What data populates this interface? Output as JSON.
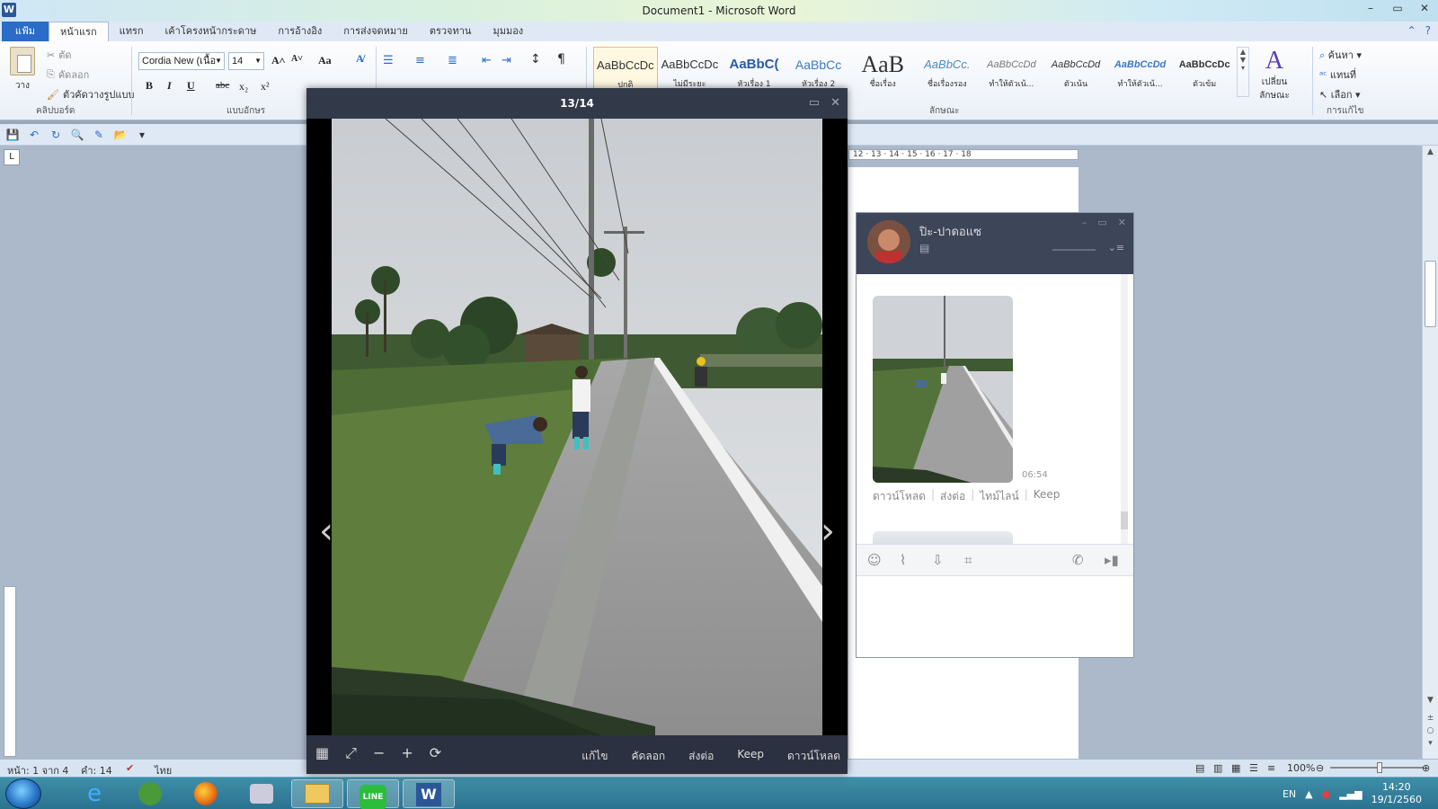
{
  "window": {
    "title": "Document1  -  Microsoft Word",
    "app_icon": "W",
    "controls": [
      "–",
      "▭",
      "✕"
    ]
  },
  "ribbon": {
    "tabs": [
      "แฟ้ม",
      "หน้าแรก",
      "แทรก",
      "เค้าโครงหน้ากระดาษ",
      "การอ้างอิง",
      "การส่งจดหมาย",
      "ตรวจทาน",
      "มุมมอง"
    ],
    "active_tab": "หน้าแรก",
    "clipboard": {
      "paste": "วาง",
      "cut": "ตัด",
      "copy": "คัดลอก",
      "format_painter": "ตัวคัดวางรูปแบบ",
      "label": "คลิปบอร์ด"
    },
    "font": {
      "name": "Cordia New (เนื้อ",
      "size": "14",
      "label": "แบบอักษร",
      "bold": "B",
      "italic": "I",
      "underline": "U",
      "strike": "abc",
      "subscript": "x₂",
      "superscript": "x²",
      "grow": "A˄",
      "shrink": "A˅",
      "case": "Aa"
    },
    "paragraph": {
      "pilcrow": "¶"
    },
    "styles": [
      {
        "sample": "AaBbCcDc",
        "name": "ปกติ"
      },
      {
        "sample": "AaBbCcDc",
        "name": "ไม่มีระยะ"
      },
      {
        "sample": "AaBbC(",
        "name": "หัวเรื่อง 1"
      },
      {
        "sample": "AaBbCc",
        "name": "หัวเรื่อง 2"
      },
      {
        "sample": "AaB",
        "name": "ชื่อเรื่อง"
      },
      {
        "sample": "AaBbCc.",
        "name": "ชื่อเรื่องรอง"
      },
      {
        "sample": "AaBbCcDd",
        "name": "ทำให้ตัวเน้..."
      },
      {
        "sample": "AaBbCcDd",
        "name": "ตัวเน้น"
      },
      {
        "sample": "AaBbCcDd",
        "name": "ทำให้ตัวเน้..."
      },
      {
        "sample": "AaBbCcDc",
        "name": "ตัวเข้ม"
      }
    ],
    "styles_label": "ลักษณะ",
    "change_styles": "เปลี่ยน ลักษณะ",
    "editing": {
      "find": "ค้นหา",
      "replace": "แทนที่",
      "select": "เลือก",
      "label": "การแก้ไข"
    }
  },
  "ruler": {
    "marks": "12 · 13 · 14 · 15 · 16 · 17 · 18"
  },
  "status": {
    "page": "หน้า: 1 จาก 4",
    "words": "คำ: 14",
    "language": "ไทย",
    "zoom": "100%",
    "zoom_level": 0.5
  },
  "viewer": {
    "counter": "13/14",
    "actions": [
      "แก้ไข",
      "คัดลอก",
      "ส่งต่อ",
      "Keep",
      "ดาวน์โหลด"
    ],
    "prev": "‹",
    "next": "›"
  },
  "chat": {
    "contact_name": "ปิะ-ปาดอแซ",
    "time": "06:54",
    "actions": [
      "ดาวน์โหลด",
      "ส่งต่อ",
      "ไทม์ไลน์",
      "Keep"
    ]
  },
  "taskbar": {
    "apps": [
      "internet-explorer",
      "app-green",
      "firefox",
      "app-gray",
      "file-explorer",
      "line",
      "word"
    ],
    "language": "EN",
    "time": "14:20",
    "date": "19/1/2560"
  },
  "colors": {
    "ribbon_file_tab": "#2a6cc7",
    "viewer_header": "#323a4a",
    "chat_header": "#3d4559",
    "taskbar": "#2a7390",
    "line_green": "#2bbd3b"
  }
}
